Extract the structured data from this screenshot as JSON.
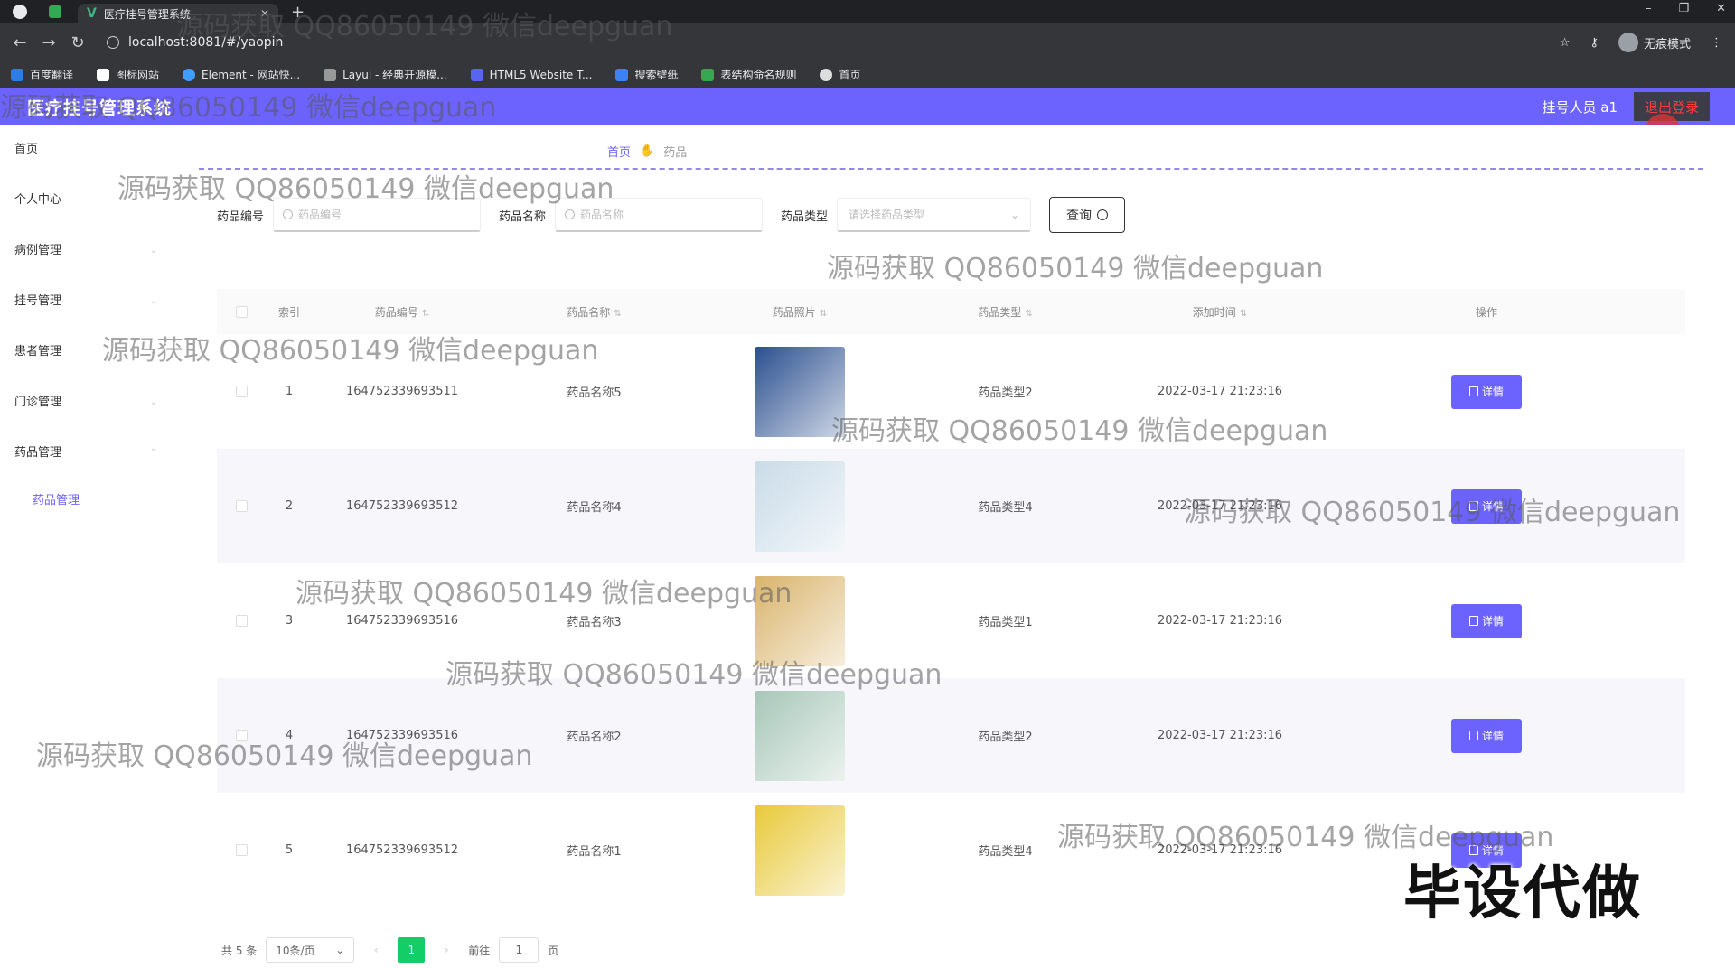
{
  "browser": {
    "tab_title": "医疗挂号管理系统",
    "url": "localhost:8081/#/yaopin",
    "incognito_label": "无痕模式",
    "bookmarks": [
      "百度翻译",
      "图标网站",
      "Element - 网站快...",
      "Layui - 经典开源模...",
      "HTML5 Website T...",
      "搜索壁纸",
      "表结构命名规则",
      "首页"
    ]
  },
  "header": {
    "title": "医疗挂号管理系统",
    "user": "挂号人员 a1",
    "logout": "退出登录"
  },
  "sidebar": {
    "items": [
      {
        "label": "首页"
      },
      {
        "label": "个人中心"
      },
      {
        "label": "病例管理"
      },
      {
        "label": "挂号管理"
      },
      {
        "label": "患者管理"
      },
      {
        "label": "门诊管理"
      },
      {
        "label": "药品管理"
      }
    ],
    "sub_item": "药品管理"
  },
  "breadcrumb": {
    "home": "首页",
    "current": "药品"
  },
  "search": {
    "code_label": "药品编号",
    "code_placeholder": "药品编号",
    "name_label": "药品名称",
    "name_placeholder": "药品名称",
    "type_label": "药品类型",
    "type_placeholder": "请选择药品类型",
    "query_button": "查询"
  },
  "table": {
    "headers": [
      "索引",
      "药品编号",
      "药品名称",
      "药品照片",
      "药品类型",
      "添加时间",
      "操作"
    ],
    "detail_label": "详情",
    "rows": [
      {
        "index": "1",
        "code": "164752339693511",
        "name": "药品名称5",
        "type": "药品类型2",
        "time": "2022-03-17 21:23:16",
        "img_color": "#2a4f8f"
      },
      {
        "index": "2",
        "code": "164752339693512",
        "name": "药品名称4",
        "type": "药品类型4",
        "time": "2022-03-17 21:23:16",
        "img_color": "#c9dbe8"
      },
      {
        "index": "3",
        "code": "164752339693516",
        "name": "药品名称3",
        "type": "药品类型1",
        "time": "2022-03-17 21:23:16",
        "img_color": "#d9b46b"
      },
      {
        "index": "4",
        "code": "164752339693516",
        "name": "药品名称2",
        "type": "药品类型2",
        "time": "2022-03-17 21:23:16",
        "img_color": "#a7c7b8"
      },
      {
        "index": "5",
        "code": "164752339693512",
        "name": "药品名称1",
        "type": "药品类型4",
        "time": "2022-03-17 21:23:16",
        "img_color": "#e8c93a"
      }
    ]
  },
  "pagination": {
    "total": "共 5 条",
    "page_size": "10条/页",
    "current": "1",
    "goto_label": "前往",
    "goto_value": "1",
    "page_unit": "页"
  },
  "watermark": "源码获取 QQ86050149 微信deepguan",
  "stamp": "毕设代做"
}
